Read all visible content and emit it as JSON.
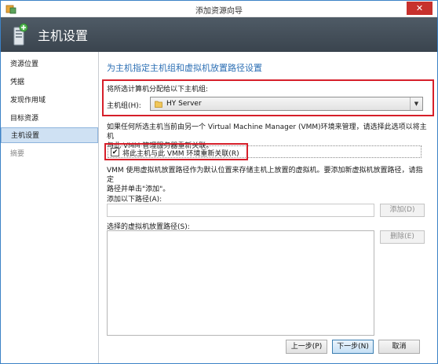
{
  "window": {
    "title": "添加资源向导",
    "close_symbol": "✕"
  },
  "header": {
    "title": "主机设置"
  },
  "sidebar": {
    "items": [
      {
        "label": "资源位置"
      },
      {
        "label": "凭据"
      },
      {
        "label": "发现作用域"
      },
      {
        "label": "目标资源"
      },
      {
        "label": "主机设置"
      },
      {
        "label": "摘要"
      }
    ]
  },
  "main": {
    "section_title": "为主机指定主机组和虚拟机放置路径设置",
    "host_group_prompt": "将所选计算机分配给以下主机组:",
    "host_group_label": "主机组(H):",
    "host_group_value": "HY Server",
    "reassociate_desc_line1": "如果任何所选主机当前由另一个 Virtual Machine Manager (VMM)环境来管理，请选择此选项以将主机",
    "reassociate_desc_line2": "与此 VMM 管理服务器重新关联。",
    "reassociate_checkbox_label": "将此主机与此 VMM 环境重新关联(R)",
    "reassociate_checked": true,
    "placement_desc_line1": "VMM 使用虚拟机放置路径作为默认位置来存储主机上放置的虚拟机。要添加新虚拟机放置路径，请指定",
    "placement_desc_line2": "路径并单击\"添加\"。",
    "add_path_label": "添加以下路径(A):",
    "add_path_value": "",
    "add_button": "添加(D)",
    "selected_paths_label": "选择的虚拟机放置路径(S):",
    "remove_button": "删除(E)"
  },
  "footer": {
    "back_button": "上一步(P)",
    "next_button": "下一步(N)",
    "cancel_button": "取消"
  },
  "colors": {
    "accent": "#2c6fb4",
    "highlight_box": "#d61f2a",
    "header_bg": "#44505a",
    "close_button": "#c7312d"
  }
}
